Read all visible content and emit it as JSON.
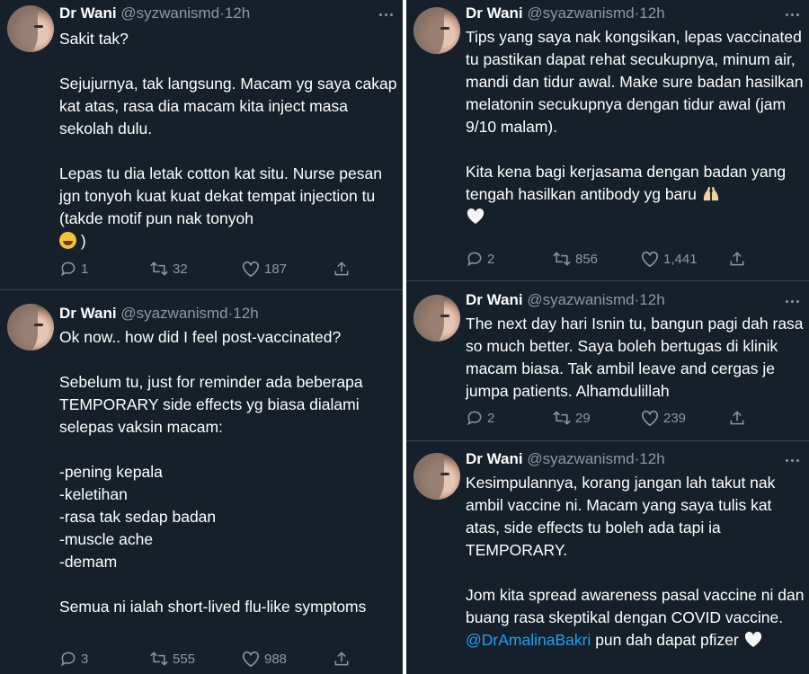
{
  "colors": {
    "background": "#15202b",
    "muted": "#8899a6",
    "link": "#1da1f2",
    "separator": "#38444d"
  },
  "tweets": [
    {
      "name": "Dr Wani",
      "handle": "@syzwanismd",
      "dot": "·",
      "time": "12h",
      "text": "Sakit tak?\n\nSejujurnya, tak langsung. Macam yg saya cakap kat atas, rasa dia macam kita inject masa sekolah dulu.\n\nLepas tu dia letak cotton kat situ. Nurse pesan jgn tonyoh kuat kuat dekat tempat injection tu (takde motif pun nak tonyoh",
      "text_end": ")",
      "emoji": "face-with-tears-of-joy",
      "replies": "1",
      "retweets": "32",
      "likes": "187"
    },
    {
      "name": "Dr Wani",
      "handle": "@syazwanismd",
      "dot": "·",
      "time": "12h",
      "text": "Ok now.. how did I feel post-vaccinated?\n\nSebelum tu, just for reminder ada beberapa TEMPORARY side effects yg biasa dialami selepas vaksin macam:\n\n-pening kepala\n-keletihan\n-rasa tak sedap badan\n-muscle ache\n-demam\n\nSemua ni ialah short-lived flu-like symptoms",
      "replies": "3",
      "retweets": "555",
      "likes": "988"
    },
    {
      "name": "Dr Wani",
      "handle": "@syazwanismd",
      "dot": "·",
      "time": "12h",
      "text": "Tips yang saya nak kongsikan, lepas vaccinated tu pastikan dapat rehat secukupnya, minum air, mandi dan tidur awal. Make sure badan hasilkan melatonin secukupnya dengan tidur awal (jam 9/10 malam).\n\nKita kena bagi kerjasama dengan badan yang tengah hasilkan antibody yg baru",
      "emoji": "raising-hands",
      "emoji2": "white-heart",
      "replies": "2",
      "retweets": "856",
      "likes": "1,441"
    },
    {
      "name": "Dr Wani",
      "handle": "@syazwanismd",
      "dot": "·",
      "time": "12h",
      "text": "The next day hari Isnin tu, bangun pagi dah rasa so much better. Saya boleh bertugas di klinik macam biasa. Tak ambil leave and cergas je jumpa patients. Alhamdulillah",
      "replies": "2",
      "retweets": "29",
      "likes": "239"
    },
    {
      "name": "Dr Wani",
      "handle": "@syazwanismd",
      "dot": "·",
      "time": "12h",
      "text": "Kesimpulannya, korang jangan lah takut nak ambil vaccine ni. Macam yang saya tulis kat atas, side effects tu boleh ada tapi ia TEMPORARY.\n\nJom kita spread awareness pasal vaccine ni dan buang rasa skeptikal dengan COVID vaccine. ",
      "mention": "@DrAmalinaBakri",
      "text_after": " pun dah dapat pfizer ",
      "emoji": "white-heart"
    }
  ]
}
